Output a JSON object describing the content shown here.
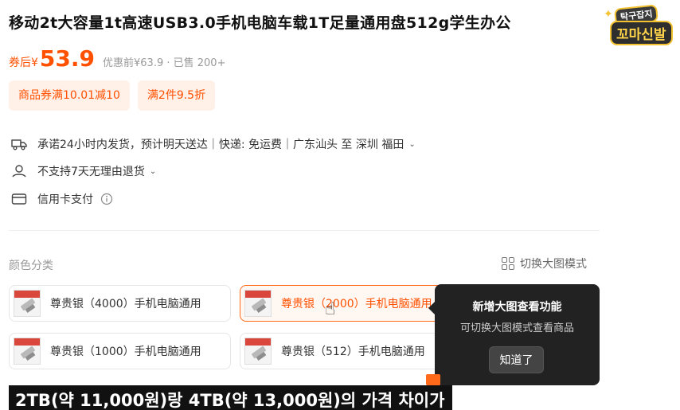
{
  "product": {
    "title": "移动2t大容量1t高速USB3.0手机电脑车载1T足量通用盘512g学生办公",
    "coupon_label": "券后¥",
    "price": "53.9",
    "price_extra": "优惠前¥63.9 · 已售 200+"
  },
  "logo": {
    "line1": "탁구잡지",
    "line2": "꼬마신발"
  },
  "badges": [
    "商品券满10.01减10",
    "满2件9.5折"
  ],
  "info": {
    "shipping": "承诺24小时内发货，预计明天送达｜快递: 免运费｜广东汕头 至 深圳 福田",
    "returns": "不支持7天无理由退货",
    "payment": "信用卡支付"
  },
  "variants": {
    "label": "颜色分类",
    "switch_label": "切换大图模式",
    "options": [
      {
        "label": "尊贵银（4000）手机电脑通用",
        "selected": false
      },
      {
        "label": "尊贵银（2000）手机电脑通用",
        "selected": true
      },
      {
        "label": "尊贵银（1000）手机电脑通用",
        "selected": false
      },
      {
        "label": "尊贵银（512）手机电脑通用",
        "selected": false
      }
    ]
  },
  "tooltip": {
    "title": "新增大图查看功能",
    "text": "可切换大图模式查看商品",
    "button": "知道了"
  },
  "subtitle": "2TB(약 11,000원)랑 4TB(약 13,000원)의 가격 차이가",
  "colors": {
    "accent": "#ff5000",
    "badge_bg": "#fff0e8",
    "tooltip_bg": "#222222"
  }
}
